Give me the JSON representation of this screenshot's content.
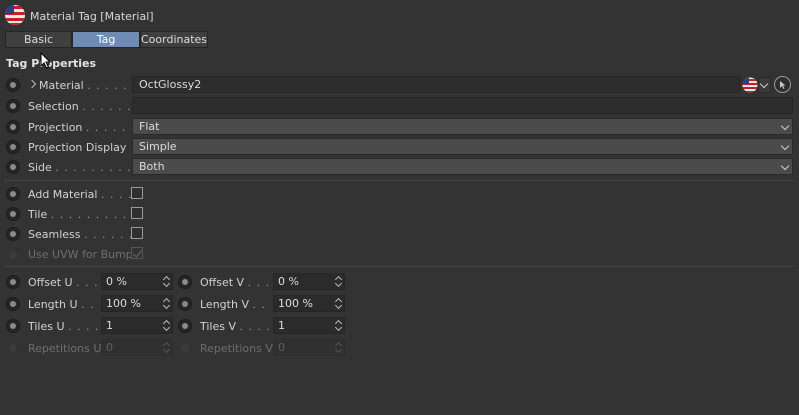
{
  "header": {
    "title": "Material Tag [Material]",
    "icon": "material-flag-icon"
  },
  "tabs": [
    {
      "label": "Basic",
      "active": false
    },
    {
      "label": "Tag",
      "active": true
    },
    {
      "label": "Coordinates",
      "active": false
    }
  ],
  "section": {
    "title": "Tag Properties"
  },
  "properties": {
    "material": {
      "label": "Material",
      "dots": ". . . . . . .",
      "value": "OctGlossy2"
    },
    "selection": {
      "label": "Selection",
      "dots": ". . . . . . .",
      "value": ""
    },
    "projection": {
      "label": "Projection",
      "dots": ". . . . . . .",
      "value": "Flat"
    },
    "projection_display": {
      "label": "Projection Display",
      "value": "Simple"
    },
    "side": {
      "label": "Side",
      "dots": ". . . . . . . . . . .",
      "value": "Both"
    }
  },
  "options": {
    "add_material": {
      "label": "Add Material",
      "dots": ". . . . .",
      "checked": false
    },
    "tile": {
      "label": "Tile",
      "dots": ". . . . . . . . . . .",
      "checked": false
    },
    "seamless": {
      "label": "Seamless",
      "dots": ". . . . . . .",
      "checked": false
    },
    "use_uvw": {
      "label": "Use UVW for Bump",
      "checked": true,
      "disabled": true
    }
  },
  "coords": {
    "offset_u": {
      "label": "Offset U",
      "dots": ". . .",
      "value": "0 %"
    },
    "offset_v": {
      "label": "Offset V",
      "dots": ". . .",
      "value": "0 %"
    },
    "length_u": {
      "label": "Length U",
      "dots": ". .",
      "value": "100 %"
    },
    "length_v": {
      "label": "Length V",
      "dots": ". .",
      "value": "100 %"
    },
    "tiles_u": {
      "label": "Tiles U",
      "dots": ". . . .",
      "value": "1"
    },
    "tiles_v": {
      "label": "Tiles V",
      "dots": ". . . .",
      "value": "1"
    },
    "repetitions_u": {
      "label": "Repetitions U",
      "value": "0"
    },
    "repetitions_v": {
      "label": "Repetitions V",
      "value": "0"
    }
  },
  "colors": {
    "background": "#333333",
    "tab_active": "#6e8cb4",
    "field": "#2d2d2d",
    "dropdown": "#4b4b4b"
  }
}
